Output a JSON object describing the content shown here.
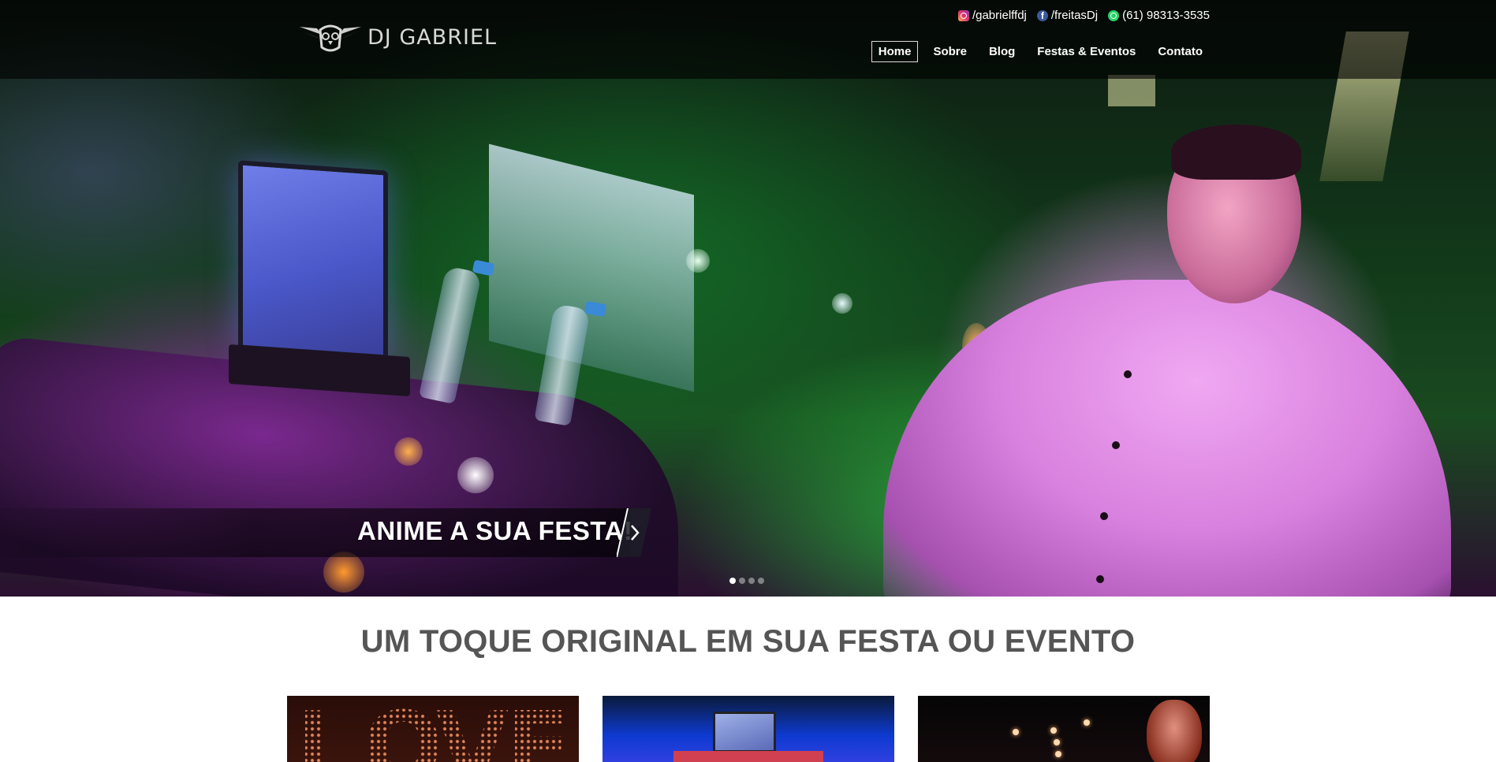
{
  "header": {
    "logo_text": "DJ GABRIEL",
    "social": [
      {
        "icon": "instagram-icon",
        "label": "/gabrielffdj"
      },
      {
        "icon": "facebook-icon",
        "label": "/freitasDj"
      },
      {
        "icon": "whatsapp-icon",
        "label": "(61) 98313-3535"
      }
    ],
    "nav": [
      {
        "label": "Home",
        "active": true
      },
      {
        "label": "Sobre",
        "active": false
      },
      {
        "label": "Blog",
        "active": false
      },
      {
        "label": "Festas & Eventos",
        "active": false
      },
      {
        "label": "Contato",
        "active": false
      }
    ]
  },
  "slider": {
    "caption": "ANIME A SUA FESTA!",
    "slide_count": 4,
    "active_slide": 1
  },
  "main": {
    "tagline": "UM TOQUE ORIGINAL EM SUA FESTA OU EVENTO",
    "card_letters": [
      "L",
      "O",
      "V",
      "E"
    ]
  },
  "colors": {
    "header_bg": "#000000",
    "tagline": "#555555",
    "nav_text": "#ffffff"
  }
}
